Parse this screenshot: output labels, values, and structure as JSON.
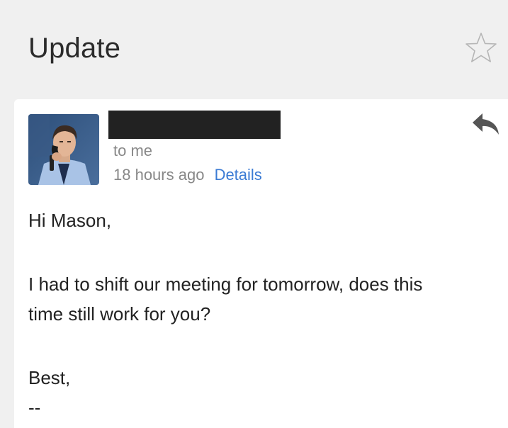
{
  "email": {
    "subject": "Update",
    "sender_redacted": true,
    "recipients": "to me",
    "timestamp": "18 hours ago",
    "details_link": "Details",
    "body": {
      "greeting": "Hi Mason,",
      "line1": "I had to shift our meeting for tomorrow, does this",
      "line2": "time still work for you?",
      "closing": "Best,",
      "signature": "--"
    }
  },
  "icons": {
    "star": "star-outline-icon",
    "reply": "reply-arrow-icon"
  },
  "colors": {
    "link": "#3b7bd4",
    "background": "#f0f0f0",
    "card": "#ffffff"
  }
}
